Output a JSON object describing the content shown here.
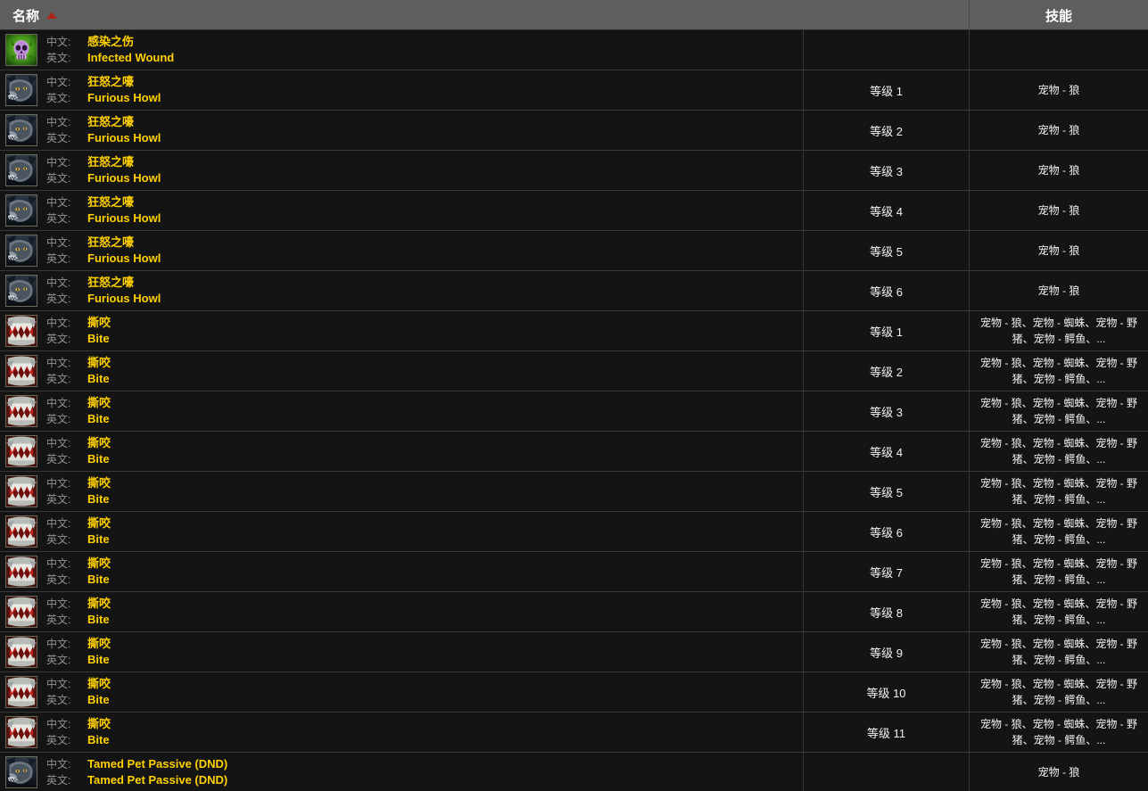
{
  "table": {
    "columns": {
      "name": {
        "label": "名称",
        "sort_indicator": "ascending-triangle"
      },
      "level": {
        "label": ""
      },
      "skill": {
        "label": "技能"
      }
    },
    "labels": {
      "cn": "中文:",
      "en": "英文:"
    },
    "colors": {
      "header_bg": "#5e5e5e",
      "row_bg": "#141414",
      "row_border": "#383838",
      "value_gold": "#ffd100",
      "label_gray": "#909090",
      "sort_caret_red": "#b02318"
    },
    "rows": [
      {
        "icon": "skull-green-icon",
        "cn": "感染之伤",
        "en": "Infected Wound",
        "level": "",
        "skill": ""
      },
      {
        "icon": "wolf-head-icon",
        "cn": "狂怒之嚎",
        "en": "Furious Howl",
        "level": "等级 1",
        "skill": "宠物 - 狼"
      },
      {
        "icon": "wolf-head-icon",
        "cn": "狂怒之嚎",
        "en": "Furious Howl",
        "level": "等级 2",
        "skill": "宠物 - 狼"
      },
      {
        "icon": "wolf-head-icon",
        "cn": "狂怒之嚎",
        "en": "Furious Howl",
        "level": "等级 3",
        "skill": "宠物 - 狼"
      },
      {
        "icon": "wolf-head-icon",
        "cn": "狂怒之嚎",
        "en": "Furious Howl",
        "level": "等级 4",
        "skill": "宠物 - 狼"
      },
      {
        "icon": "wolf-head-icon",
        "cn": "狂怒之嚎",
        "en": "Furious Howl",
        "level": "等级 5",
        "skill": "宠物 - 狼"
      },
      {
        "icon": "wolf-head-icon",
        "cn": "狂怒之嚎",
        "en": "Furious Howl",
        "level": "等级 6",
        "skill": "宠物 - 狼"
      },
      {
        "icon": "bite-mouth-icon",
        "cn": "撕咬",
        "en": "Bite",
        "level": "等级 1",
        "skill": "宠物 - 狼、宠物 - 蜘蛛、宠物 - 野猪、宠物 - 鳄鱼、..."
      },
      {
        "icon": "bite-mouth-icon",
        "cn": "撕咬",
        "en": "Bite",
        "level": "等级 2",
        "skill": "宠物 - 狼、宠物 - 蜘蛛、宠物 - 野猪、宠物 - 鳄鱼、..."
      },
      {
        "icon": "bite-mouth-icon",
        "cn": "撕咬",
        "en": "Bite",
        "level": "等级 3",
        "skill": "宠物 - 狼、宠物 - 蜘蛛、宠物 - 野猪、宠物 - 鳄鱼、..."
      },
      {
        "icon": "bite-mouth-icon",
        "cn": "撕咬",
        "en": "Bite",
        "level": "等级 4",
        "skill": "宠物 - 狼、宠物 - 蜘蛛、宠物 - 野猪、宠物 - 鳄鱼、..."
      },
      {
        "icon": "bite-mouth-icon",
        "cn": "撕咬",
        "en": "Bite",
        "level": "等级 5",
        "skill": "宠物 - 狼、宠物 - 蜘蛛、宠物 - 野猪、宠物 - 鳄鱼、..."
      },
      {
        "icon": "bite-mouth-icon",
        "cn": "撕咬",
        "en": "Bite",
        "level": "等级 6",
        "skill": "宠物 - 狼、宠物 - 蜘蛛、宠物 - 野猪、宠物 - 鳄鱼、..."
      },
      {
        "icon": "bite-mouth-icon",
        "cn": "撕咬",
        "en": "Bite",
        "level": "等级 7",
        "skill": "宠物 - 狼、宠物 - 蜘蛛、宠物 - 野猪、宠物 - 鳄鱼、..."
      },
      {
        "icon": "bite-mouth-icon",
        "cn": "撕咬",
        "en": "Bite",
        "level": "等级 8",
        "skill": "宠物 - 狼、宠物 - 蜘蛛、宠物 - 野猪、宠物 - 鳄鱼、..."
      },
      {
        "icon": "bite-mouth-icon",
        "cn": "撕咬",
        "en": "Bite",
        "level": "等级 9",
        "skill": "宠物 - 狼、宠物 - 蜘蛛、宠物 - 野猪、宠物 - 鳄鱼、..."
      },
      {
        "icon": "bite-mouth-icon",
        "cn": "撕咬",
        "en": "Bite",
        "level": "等级 10",
        "skill": "宠物 - 狼、宠物 - 蜘蛛、宠物 - 野猪、宠物 - 鳄鱼、..."
      },
      {
        "icon": "bite-mouth-icon",
        "cn": "撕咬",
        "en": "Bite",
        "level": "等级 11",
        "skill": "宠物 - 狼、宠物 - 蜘蛛、宠物 - 野猪、宠物 - 鳄鱼、..."
      },
      {
        "icon": "wolf-head-icon",
        "cn": "Tamed Pet Passive (DND)",
        "en": "Tamed Pet Passive (DND)",
        "level": "",
        "skill": "宠物 - 狼"
      }
    ]
  }
}
